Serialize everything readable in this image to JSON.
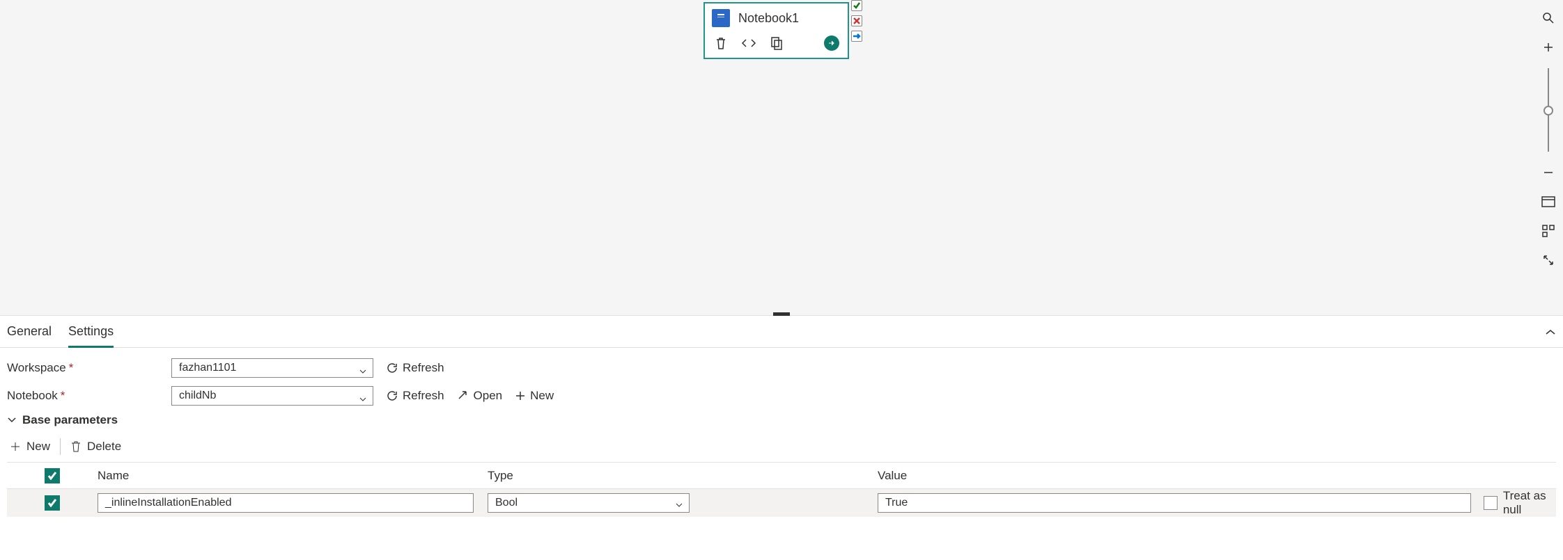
{
  "node": {
    "title": "Notebook1",
    "icon": "notebook"
  },
  "status": {
    "ok": "ok",
    "fail": "fail",
    "fwd": "forward"
  },
  "tabs": {
    "general": "General",
    "settings": "Settings",
    "active": "settings"
  },
  "fields": {
    "workspace_label": "Workspace",
    "workspace_value": "fazhan1101",
    "notebook_label": "Notebook",
    "notebook_value": "childNb"
  },
  "buttons": {
    "refresh": "Refresh",
    "open": "Open",
    "new": "New",
    "delete": "Delete"
  },
  "section": {
    "base_params": "Base parameters"
  },
  "grid": {
    "name_header": "Name",
    "type_header": "Type",
    "value_header": "Value",
    "treat_as_null": "Treat as null"
  },
  "row0": {
    "name": "_inlineInstallationEnabled",
    "type": "Bool",
    "value": "True"
  }
}
